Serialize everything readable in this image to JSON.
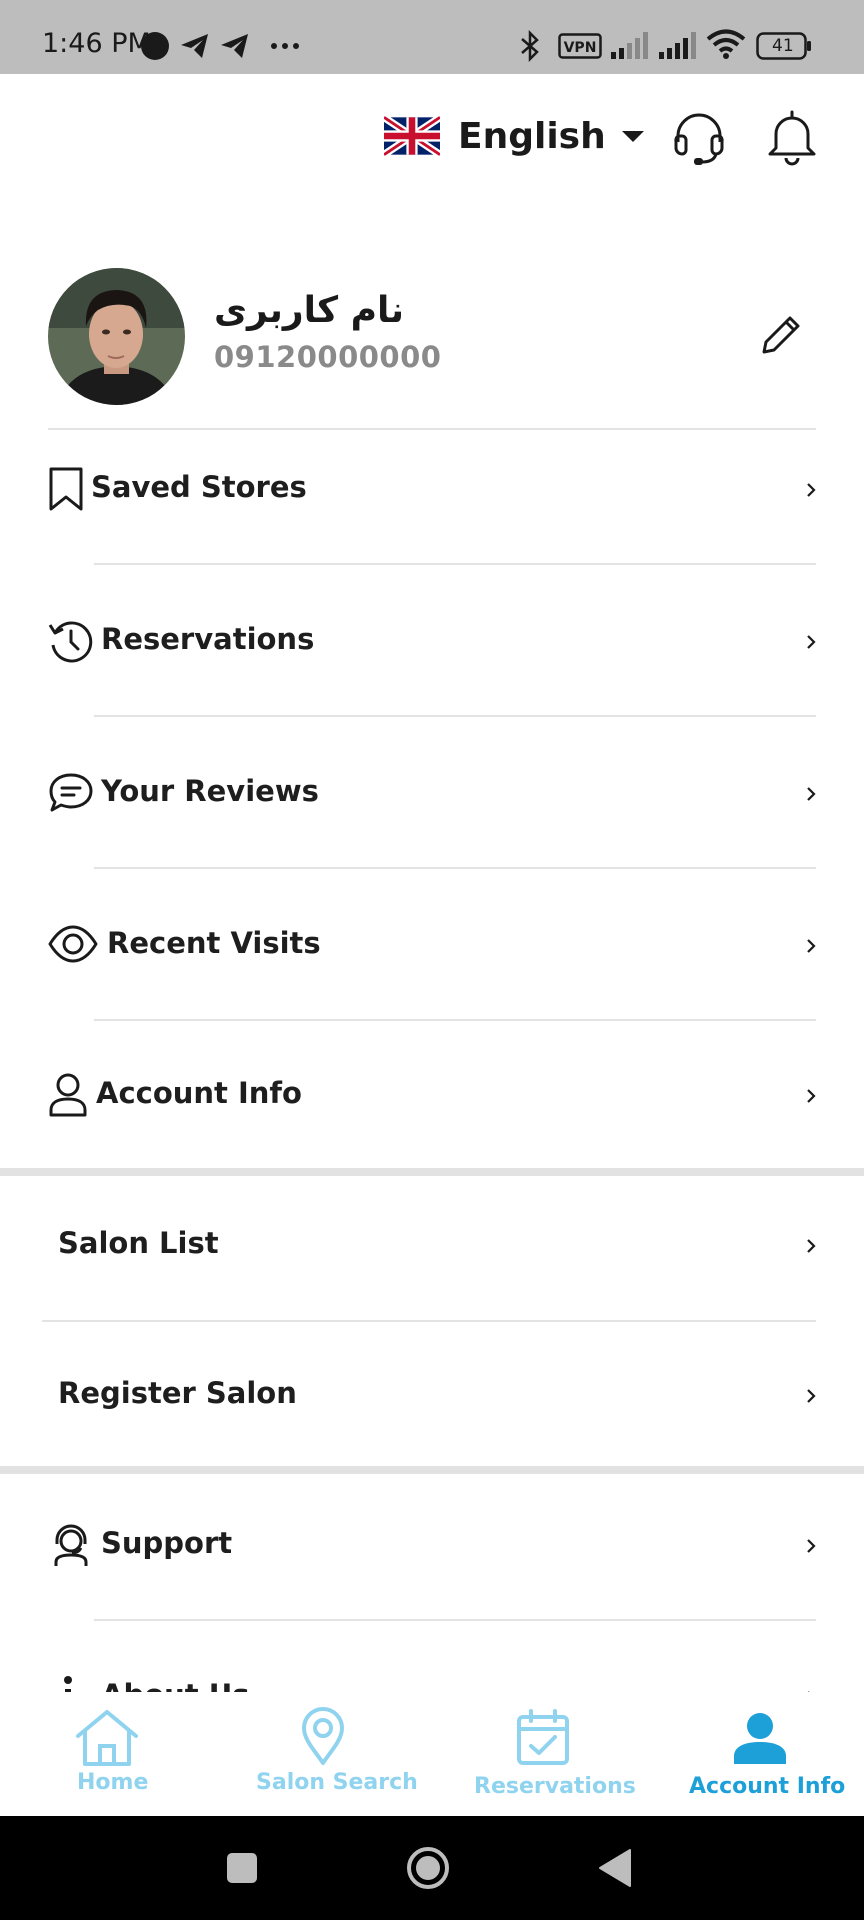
{
  "status_bar": {
    "time": "1:46 PM",
    "battery_level": "41",
    "vpn_label": "VPN",
    "icons": [
      "record-dot-icon",
      "telegram-icon",
      "telegram-icon",
      "more-dots-icon",
      "bluetooth-icon",
      "vpn-icon",
      "signal-icon",
      "signal-icon",
      "wifi-icon",
      "battery-icon"
    ]
  },
  "header": {
    "language_label": "English",
    "language_flag": "uk-flag-icon",
    "support_icon": "headset-icon",
    "notification_icon": "bell-icon"
  },
  "profile": {
    "name": "نام کاربری",
    "phone": "09120000000",
    "edit_icon": "pencil-icon"
  },
  "menu_group_1": [
    {
      "label": "Saved Stores",
      "icon": "bookmark-icon"
    },
    {
      "label": "Reservations",
      "icon": "history-icon"
    },
    {
      "label": "Your Reviews",
      "icon": "chat-icon"
    },
    {
      "label": "Recent Visits",
      "icon": "eye-icon"
    },
    {
      "label": "Account Info",
      "icon": "user-icon"
    }
  ],
  "menu_group_2": [
    {
      "label": "Salon List"
    },
    {
      "label": "Register Salon"
    }
  ],
  "menu_group_3": [
    {
      "label": "Support",
      "icon": "support-agent-icon"
    },
    {
      "label": "About Us",
      "icon": "info-icon"
    }
  ],
  "bottom_nav": {
    "items": [
      {
        "label": "Home",
        "icon": "home-icon",
        "active": false
      },
      {
        "label": "Salon Search",
        "icon": "map-pin-icon",
        "active": false
      },
      {
        "label": "Reservations",
        "icon": "calendar-check-icon",
        "active": false
      },
      {
        "label": "Account Info",
        "icon": "person-icon",
        "active": true
      }
    ],
    "active_color": "#1d9fd8",
    "inactive_color": "#8fd3ef"
  },
  "system_nav": {
    "buttons": [
      "recents-button",
      "home-button",
      "back-button"
    ]
  },
  "colors": {
    "accent": "#1d9fd8",
    "accent_light": "#8fd3ef",
    "text": "#1e1e1e",
    "muted": "#8a8a8a",
    "divider": "#e3e3e3",
    "status_bar": "#bdbdbd"
  }
}
